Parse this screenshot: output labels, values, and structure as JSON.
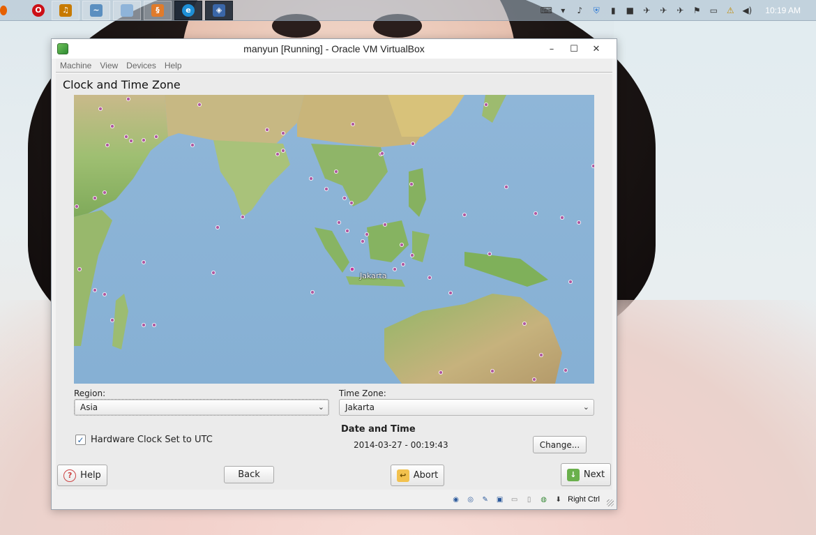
{
  "taskbar": {
    "apps": [
      {
        "icon": "firefox-icon",
        "color": "#e66000"
      },
      {
        "icon": "opera-icon",
        "color": "#cc0f16"
      },
      {
        "icon": "music-player-icon",
        "color": "#c77a00"
      },
      {
        "icon": "monitor-icon",
        "color": "#5b8fc0"
      },
      {
        "icon": "notepad-icon",
        "color": "#8fb4d9"
      },
      {
        "icon": "app-icon",
        "color": "#e07b2a"
      },
      {
        "icon": "ie-icon",
        "color": "#1e8fd6"
      },
      {
        "icon": "virtualbox-icon",
        "color": "#3a66a8"
      }
    ],
    "clock": "10:19 AM"
  },
  "window": {
    "title": "manyun [Running] - Oracle VM VirtualBox",
    "menu": [
      "Machine",
      "View",
      "Devices",
      "Help"
    ]
  },
  "installer": {
    "page_title": "Clock and Time Zone",
    "map_city_label": "Jakarta",
    "region_label": "Region:",
    "region_value": "Asia",
    "timezone_label": "Time Zone:",
    "timezone_value": "Jakarta",
    "hw_clock_label": "Hardware Clock Set to UTC",
    "hw_clock_checked": true,
    "date_time_title": "Date and Time",
    "date_time_value": "2014-03-27 - 00:19:43",
    "change_button": "Change...",
    "buttons": {
      "help": "Help",
      "back": "Back",
      "abort": "Abort",
      "next": "Next"
    }
  },
  "statusbar": {
    "host_key": "Right Ctrl"
  }
}
